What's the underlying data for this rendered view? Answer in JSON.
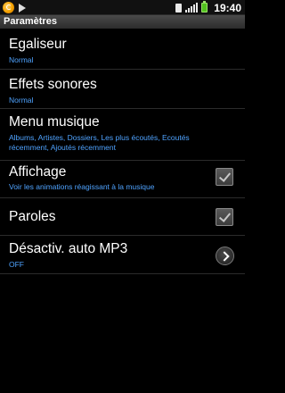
{
  "status_bar": {
    "time": "19:40",
    "icons": [
      "app-icon",
      "play-icon",
      "sim-icon",
      "signal-icon",
      "battery-icon"
    ],
    "battery_color": "#52c21f"
  },
  "title_bar": {
    "title": "Paramètres"
  },
  "settings": [
    {
      "title": "Egaliseur",
      "summary": "Normal"
    },
    {
      "title": "Effets sonores",
      "summary": "Normal"
    },
    {
      "title": "Menu musique",
      "summary": "Albums, Artistes, Dossiers, Les plus écoutés, Ecoutés récemment, Ajoutés récemment"
    },
    {
      "title": "Affichage",
      "summary": "Voir les animations réagissant à la musique",
      "checked": true
    },
    {
      "title": "Paroles",
      "checked": true
    },
    {
      "title": "Désactiv. auto MP3",
      "summary": "OFF",
      "action_icon": "chevron-right-icon"
    }
  ],
  "colors": {
    "summary_text": "#4fa3ff",
    "background": "#000000"
  }
}
